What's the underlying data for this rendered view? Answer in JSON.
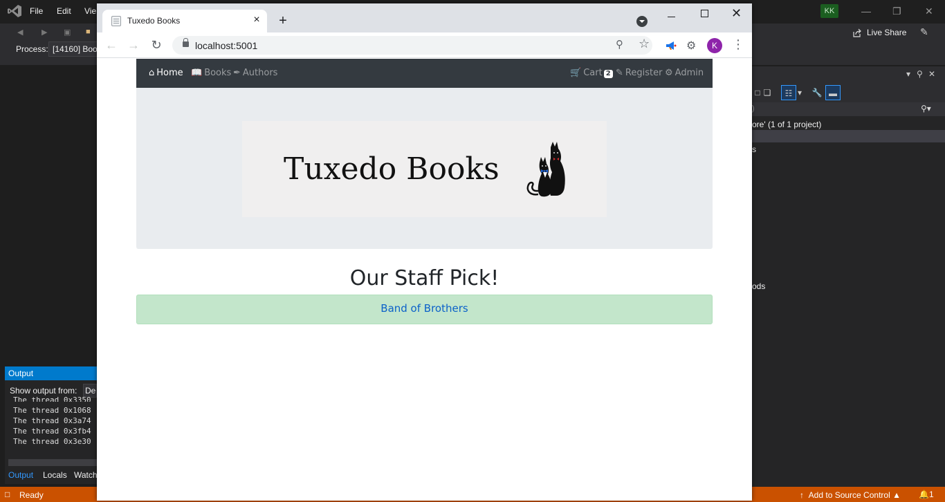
{
  "vs": {
    "menu": [
      "File",
      "Edit",
      "Vie"
    ],
    "process_label": "Process:",
    "process_value": "[14160] Boo",
    "account_initials": "KK",
    "live_share": "Live Share",
    "solution_explorer": {
      "search_fragment": ")",
      "project_line": "ore' (1 of 1 project)",
      "line_s": "s",
      "line_ods": "ods"
    },
    "output": {
      "title": "Output",
      "show_from_label": "Show output from:",
      "show_from_value": "De",
      "lines": [
        "The thread 0x3350",
        "The thread 0x1068",
        "The thread 0x3a74",
        "The thread 0x3fb4",
        "The thread 0x3e30"
      ]
    },
    "bottom_tabs": [
      "Output",
      "Locals",
      "Watch"
    ],
    "status": {
      "ready": "Ready",
      "source_control": "Add to Source Control",
      "notifications": "1"
    }
  },
  "browser": {
    "tab_title": "Tuxedo Books",
    "url": "localhost:5001",
    "profile_initial": "K"
  },
  "site": {
    "nav": {
      "home": "Home",
      "books": "Books",
      "authors": "Authors",
      "cart": "Cart",
      "cart_count": "2",
      "register": "Register",
      "admin": "Admin"
    },
    "logo_text": "Tuxedo Books",
    "staff_heading": "Our Staff Pick!",
    "staff_pick_title": "Band of Brothers"
  },
  "colors": {
    "vs_accent": "#007acc",
    "vs_status": "#ca5100",
    "site_nav_bg": "#343a40",
    "jumbotron_bg": "#e9ecef",
    "pick_bg": "#c3e6cb",
    "link": "#0b61c9",
    "profile": "#8e24aa"
  }
}
